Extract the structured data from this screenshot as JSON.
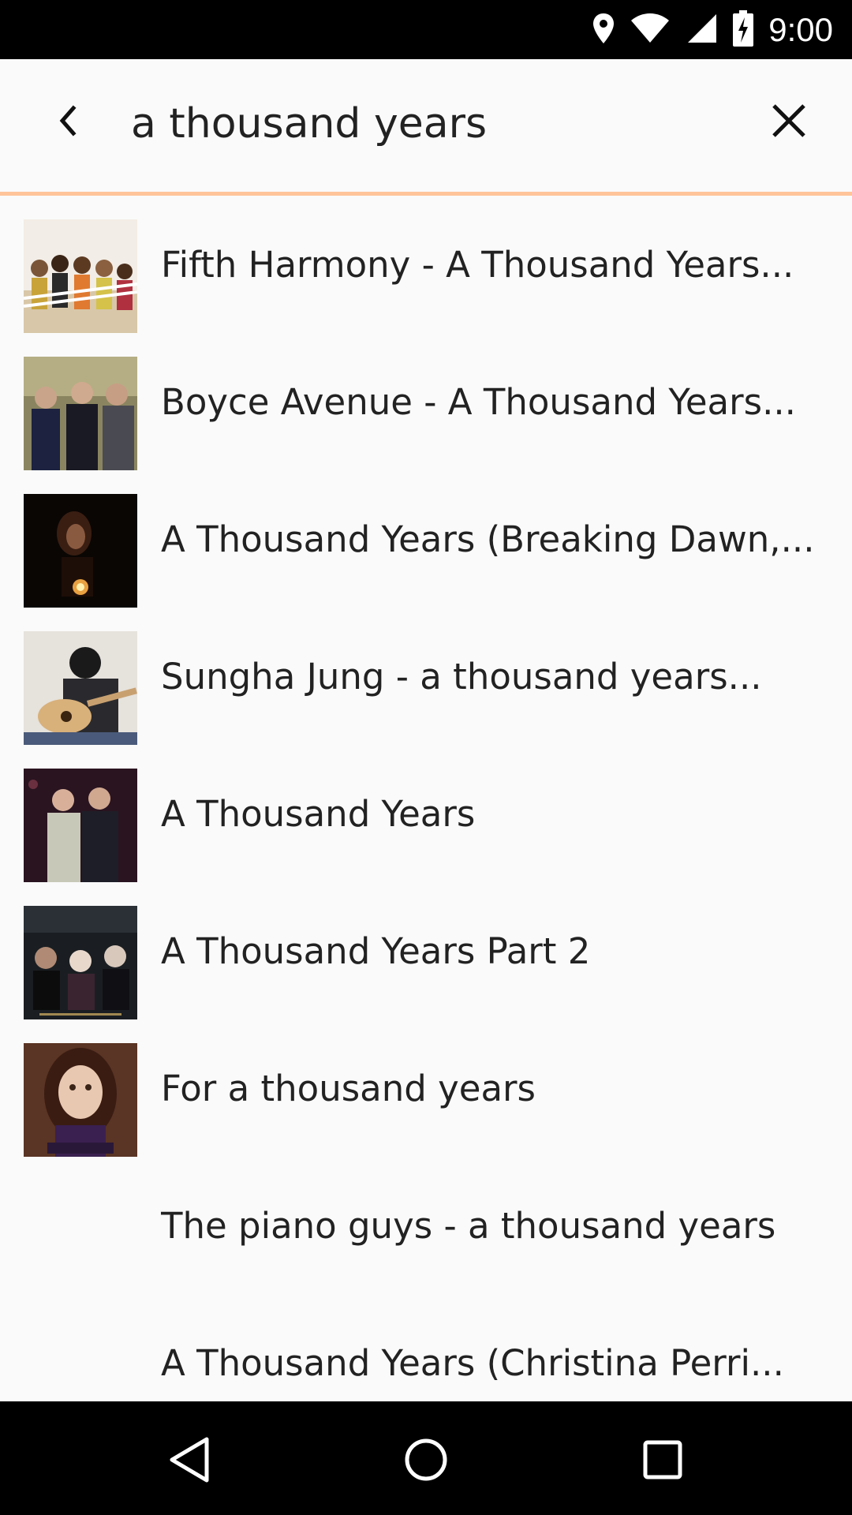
{
  "status_bar": {
    "time": "9:00",
    "icons": [
      "location-icon",
      "wifi-icon",
      "signal-icon",
      "battery-charging-icon"
    ]
  },
  "search": {
    "query": "a thousand years",
    "back_icon": "chevron-left-icon",
    "clear_icon": "close-icon",
    "accent_color": "#ffc49a"
  },
  "results": [
    {
      "title": "Fifth Harmony - A Thousand Years...",
      "has_thumbnail": true
    },
    {
      "title": "Boyce Avenue -  A Thousand Years...",
      "has_thumbnail": true
    },
    {
      "title": "A Thousand Years (Breaking Dawn,...",
      "has_thumbnail": true
    },
    {
      "title": "Sungha Jung - a thousand years...",
      "has_thumbnail": true
    },
    {
      "title": "A Thousand Years",
      "has_thumbnail": true
    },
    {
      "title": "A Thousand Years Part 2",
      "has_thumbnail": true
    },
    {
      "title": "For a thousand years",
      "has_thumbnail": true
    },
    {
      "title": "The piano guys - a thousand years",
      "has_thumbnail": false
    },
    {
      "title": "A Thousand Years (Christina Perri...",
      "has_thumbnail": false
    }
  ],
  "nav_bar": {
    "icons": [
      "back-triangle-icon",
      "home-circle-icon",
      "recents-square-icon"
    ]
  }
}
